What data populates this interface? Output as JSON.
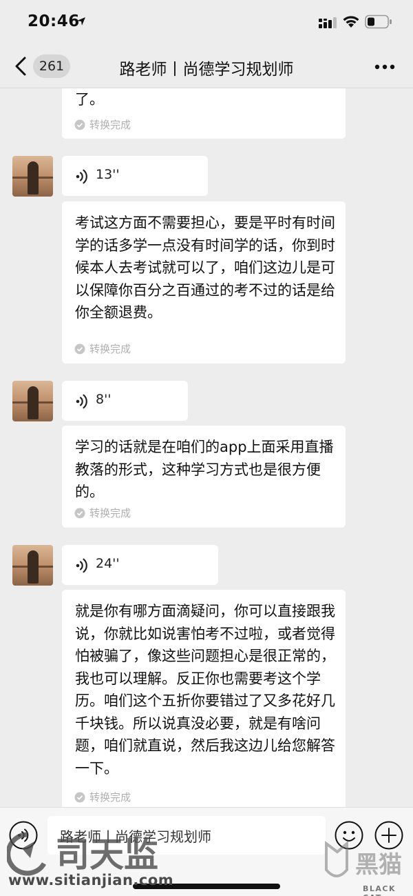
{
  "status_bar": {
    "time": "20:46"
  },
  "nav": {
    "unread_count": "261",
    "title": "路老师丨尚德学习规划师"
  },
  "messages": [
    {
      "type": "text",
      "text": "了。",
      "status": "转换完成"
    },
    {
      "type": "voice",
      "duration": "13''"
    },
    {
      "type": "text",
      "text": "考试这方面不需要担心，要是平时有时间学的话多学一点没有时间学的话，你到时候本人去考试就可以了，咱们这边儿是可以保障你百分之百通过的考不过的话是给你全额退费。",
      "status": "转换完成"
    },
    {
      "type": "voice",
      "duration": "8''"
    },
    {
      "type": "text",
      "text": "学习的话就是在咱们的app上面采用直播教落的形式，这种学习方式也是很方便的。",
      "status": "转换完成"
    },
    {
      "type": "voice",
      "duration": "24''"
    },
    {
      "type": "text",
      "text": "就是你有哪方面滴疑问，你可以直接跟我说，你就比如说害怕考不过啦，或者觉得怕被骗了，像这些问题担心是很正常的，我也可以理解。反正你也需要考这个学历。咱们这个五折你要错过了又多花好几千块钱。所以说真没必要，就是有啥问题，咱们就直说，然后我这边儿给您解答一下。",
      "status": "转换完成"
    }
  ],
  "input_bar": {
    "value": "路老师丨尚德学习规划师"
  },
  "watermarks": {
    "left_url": "www.sitianjian.com",
    "left_brand": "司天监",
    "right_brand": "黑猫",
    "right_sub": "BLACK CAT"
  },
  "colors": {
    "background": "#ededed",
    "bubble": "#ffffff",
    "status_text": "#b0b0b0"
  }
}
